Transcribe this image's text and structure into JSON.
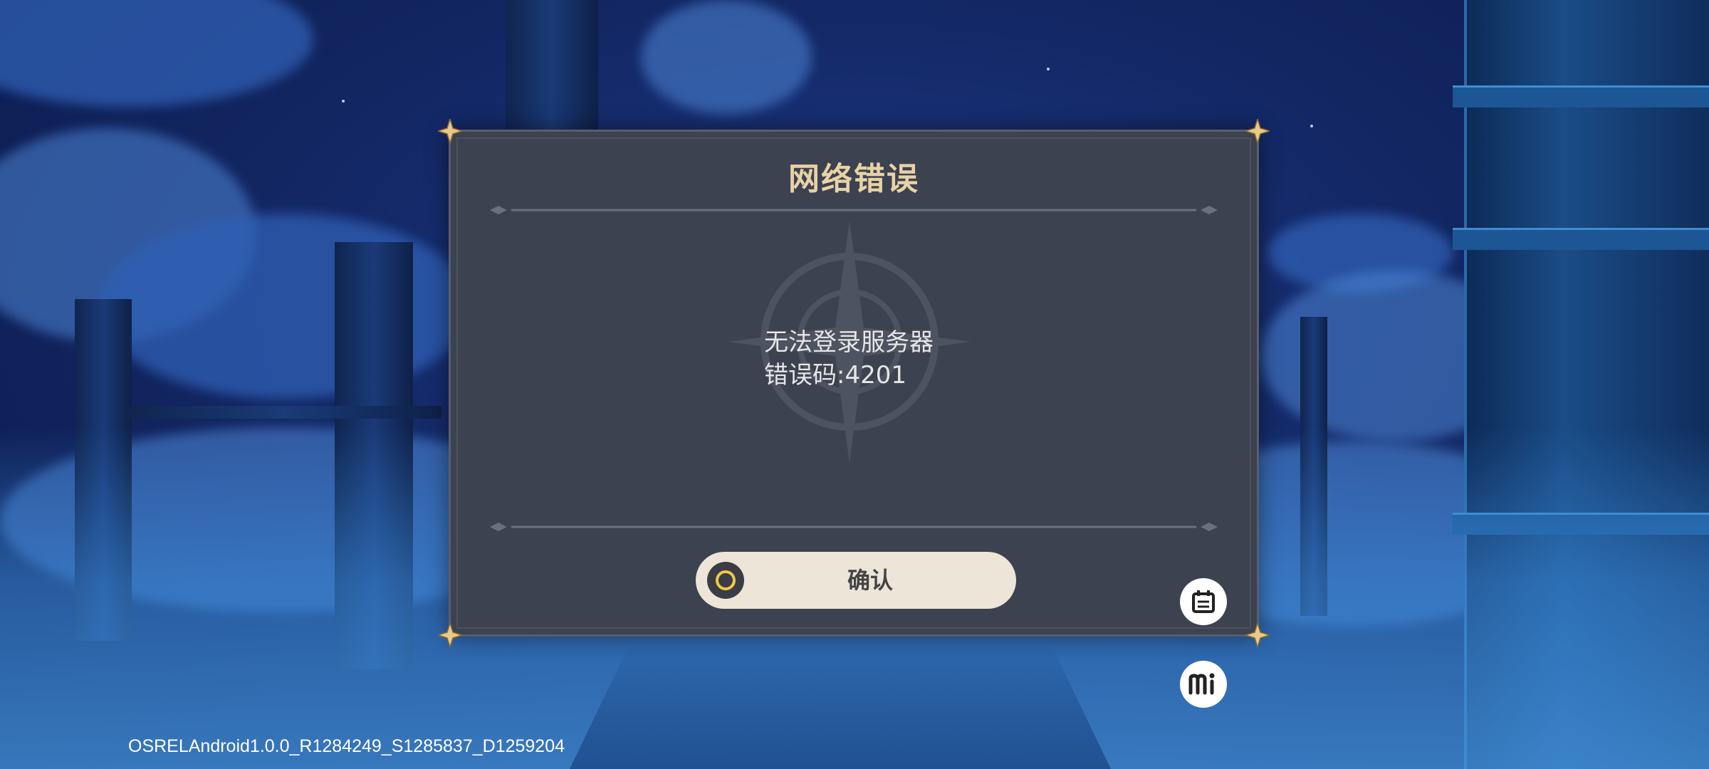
{
  "dialog": {
    "title": "网络错误",
    "message_line1": "无法登录服务器",
    "message_line2": "错误码:4201",
    "confirm_label": "确认"
  },
  "footer": {
    "version": "OSRELAndroid1.0.0_R1284249_S1285837_D1259204"
  },
  "side_buttons": [
    {
      "icon": "notice-board-icon"
    },
    {
      "icon": "mi-logo-icon"
    }
  ],
  "colors": {
    "title": "#e8d3a6",
    "dialog_bg": "#3d4250",
    "button_bg": "#ece5d8",
    "button_ring": "#f2c744"
  }
}
